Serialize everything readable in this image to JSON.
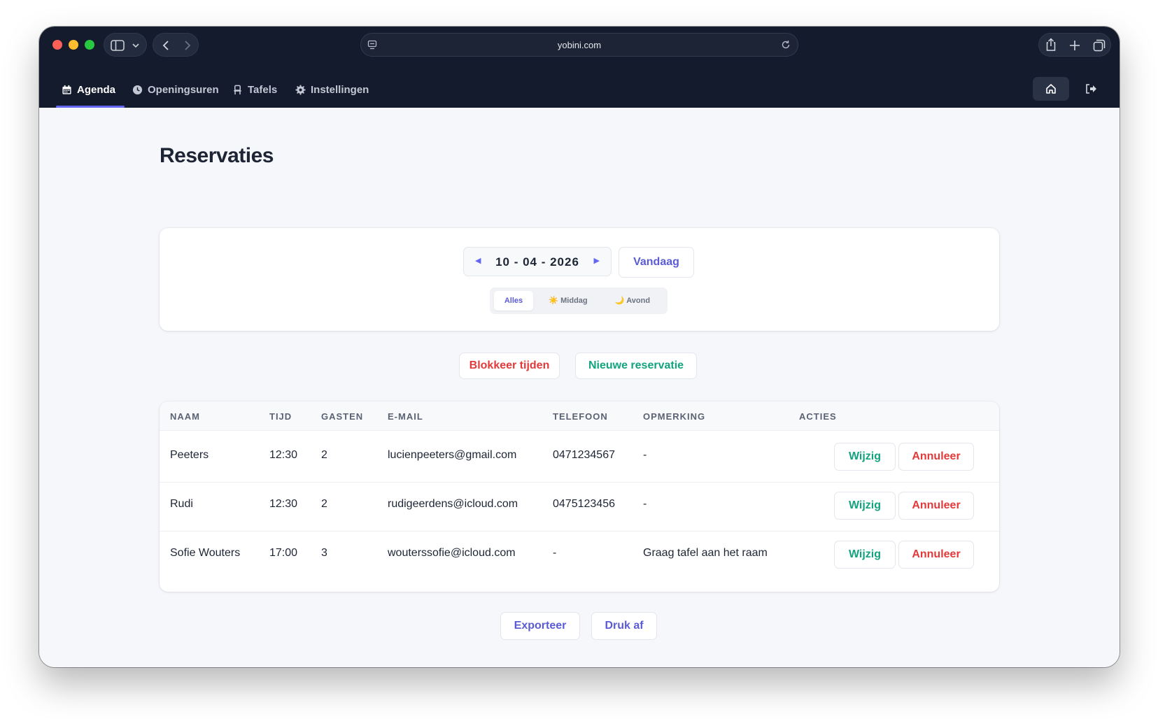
{
  "browser": {
    "url": "yobini.com"
  },
  "nav": {
    "items": [
      {
        "label": "Agenda",
        "icon": "calendar-icon",
        "active": true
      },
      {
        "label": "Openingsuren",
        "icon": "clock-icon",
        "active": false
      },
      {
        "label": "Tafels",
        "icon": "chair-icon",
        "active": false
      },
      {
        "label": "Instellingen",
        "icon": "gear-icon",
        "active": false
      }
    ]
  },
  "page": {
    "title": "Reservaties"
  },
  "date_picker": {
    "date": "10 - 04 - 2026",
    "prev": "◀",
    "next": "▶",
    "today_label": "Vandaag"
  },
  "filter": {
    "options": [
      "Alles",
      "☀️ Middag",
      "🌙 Avond"
    ],
    "selected": "Alles"
  },
  "actions": {
    "block_label": "Blokkeer tijden",
    "new_label": "Nieuwe reservatie"
  },
  "table": {
    "headers": [
      "NAAM",
      "TIJD",
      "GASTEN",
      "E-MAIL",
      "TELEFOON",
      "OPMERKING",
      "ACTIES"
    ],
    "rows": [
      {
        "name": "Peeters",
        "time": "12:30",
        "guests": "2",
        "email": "lucienpeeters@gmail.com",
        "phone": "0471234567",
        "note": "-"
      },
      {
        "name": "Rudi",
        "time": "12:30",
        "guests": "2",
        "email": "rudigeerdens@icloud.com",
        "phone": "0475123456",
        "note": "-"
      },
      {
        "name": "Sofie Wouters",
        "time": "17:00",
        "guests": "3",
        "email": "wouterssofie@icloud.com",
        "phone": "-",
        "note": "Graag tafel aan het raam"
      }
    ],
    "edit_label": "Wijzig",
    "cancel_label": "Annuleer"
  },
  "footer": {
    "export_label": "Exporteer",
    "print_label": "Druk af"
  },
  "colors": {
    "accent": "#6366f1",
    "success": "#14a37f",
    "danger": "#e23a3a",
    "navbar": "#141b2d"
  }
}
